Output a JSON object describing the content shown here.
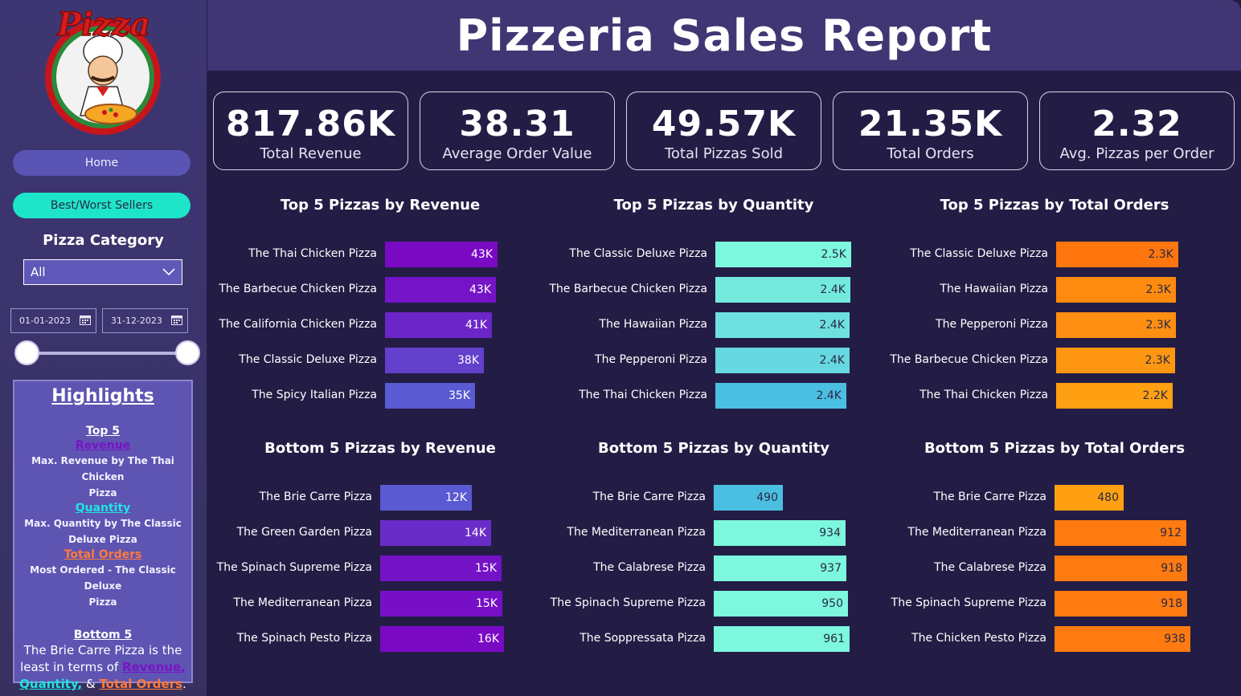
{
  "header": {
    "title": "Pizzeria Sales Report"
  },
  "sidebar": {
    "logo_text": "Pizza",
    "nav": {
      "home": "Home",
      "best_worst": "Best/Worst Sellers"
    },
    "category_title": "Pizza Category",
    "category_selected": "All",
    "date_start": "01-01-2023",
    "date_end": "31-12-2023",
    "highlights": {
      "title": "Highlights",
      "top5_heading": "Top 5",
      "revenue_label": "Revenue",
      "revenue_line1": "Max. Revenue by The Thai Chicken",
      "revenue_line2": "Pizza",
      "quantity_label": "Quantity",
      "quantity_line1": "Max. Quantity by The Classic",
      "quantity_line2": "Deluxe Pizza",
      "orders_label": "Total Orders",
      "orders_line1": "Most Ordered - The Classic Deluxe",
      "orders_line2": "Pizza",
      "bottom5_heading": "Bottom 5",
      "bottom_line1": "The Brie Carre Pizza is the",
      "bottom_line2_prefix": "least in terms of ",
      "bottom_revenue": "Revenue,",
      "bottom_quantity": "Quantity,",
      "bottom_amp": " & ",
      "bottom_orders": "Total Orders",
      "bottom_period": "."
    }
  },
  "kpis": [
    {
      "value": "817.86K",
      "label": "Total Revenue"
    },
    {
      "value": "38.31",
      "label": "Average Order Value"
    },
    {
      "value": "49.57K",
      "label": "Total Pizzas Sold"
    },
    {
      "value": "21.35K",
      "label": "Total Orders"
    },
    {
      "value": "2.32",
      "label": "Avg. Pizzas per Order"
    }
  ],
  "chart_data": [
    {
      "type": "bar",
      "orientation": "horizontal",
      "title": "Top 5 Pizzas by Revenue",
      "categories": [
        "The Thai Chicken Pizza",
        "The Barbecue Chicken Pizza",
        "The California Chicken Pizza",
        "The Classic Deluxe Pizza",
        "The Spicy Italian Pizza"
      ],
      "values": [
        43434,
        42768,
        41410,
        38181,
        34831
      ],
      "labels": [
        "43K",
        "43K",
        "41K",
        "38K",
        "35K"
      ],
      "colors": [
        "#7a09c4",
        "#7414c6",
        "#6c25c8",
        "#6240cc",
        "#5a5ad2"
      ],
      "scale_max": 43434
    },
    {
      "type": "bar",
      "orientation": "horizontal",
      "title": "Top 5 Pizzas by Quantity",
      "categories": [
        "The Classic Deluxe Pizza",
        "The Barbecue Chicken Pizza",
        "The Hawaiian Pizza",
        "The Pepperoni Pizza",
        "The Thai Chicken Pizza"
      ],
      "values": [
        2453,
        2432,
        2422,
        2418,
        2371
      ],
      "labels": [
        "2.5K",
        "2.4K",
        "2.4K",
        "2.4K",
        "2.4K"
      ],
      "colors": [
        "#7df7de",
        "#74eadf",
        "#6ee0e0",
        "#66d8e0",
        "#4bbfe2"
      ],
      "scale_max": 2453
    },
    {
      "type": "bar",
      "orientation": "horizontal",
      "title": "Top 5 Pizzas by Total Orders",
      "categories": [
        "The Classic Deluxe Pizza",
        "The Hawaiian Pizza",
        "The Pepperoni Pizza",
        "The Barbecue Chicken Pizza",
        "The Thai Chicken Pizza"
      ],
      "values": [
        2329,
        2280,
        2278,
        2273,
        2225
      ],
      "labels": [
        "2.3K",
        "2.3K",
        "2.3K",
        "2.3K",
        "2.2K"
      ],
      "colors": [
        "#ff760e",
        "#ff8a10",
        "#ff8f12",
        "#ff9612",
        "#ffa012"
      ],
      "scale_max": 2329
    },
    {
      "type": "bar",
      "orientation": "horizontal",
      "title": "Bottom 5 Pizzas by Revenue",
      "categories": [
        "The Brie Carre Pizza",
        "The Green Garden Pizza",
        "The Spinach Supreme Pizza",
        "The Mediterranean Pizza",
        "The Spinach Pesto Pizza"
      ],
      "values": [
        11588,
        13956,
        15278,
        15360,
        15596
      ],
      "labels": [
        "12K",
        "14K",
        "15K",
        "15K",
        "16K"
      ],
      "colors": [
        "#5a5ad2",
        "#6a2cc8",
        "#7412c6",
        "#760fc6",
        "#7a09c4"
      ],
      "scale_max": 15596
    },
    {
      "type": "bar",
      "orientation": "horizontal",
      "title": "Bottom 5 Pizzas by Quantity",
      "categories": [
        "The Brie Carre Pizza",
        "The Mediterranean Pizza",
        "The Calabrese Pizza",
        "The Spinach Supreme Pizza",
        "The Soppressata Pizza"
      ],
      "values": [
        490,
        934,
        937,
        950,
        961
      ],
      "labels": [
        "490",
        "934",
        "937",
        "950",
        "961"
      ],
      "colors": [
        "#4bbfe2",
        "#7df7de",
        "#7df7de",
        "#7df7de",
        "#7df7de"
      ],
      "scale_max": 961
    },
    {
      "type": "bar",
      "orientation": "horizontal",
      "title": "Bottom 5 Pizzas by Total Orders",
      "categories": [
        "The Brie Carre Pizza",
        "The Mediterranean Pizza",
        "The Calabrese Pizza",
        "The Spinach Supreme Pizza",
        "The Chicken Pesto Pizza"
      ],
      "values": [
        480,
        912,
        918,
        918,
        938
      ],
      "labels": [
        "480",
        "912",
        "918",
        "918",
        "938"
      ],
      "colors": [
        "#ffa012",
        "#ff7a10",
        "#ff7a10",
        "#ff7a10",
        "#ff7a10"
      ],
      "scale_max": 938
    }
  ]
}
